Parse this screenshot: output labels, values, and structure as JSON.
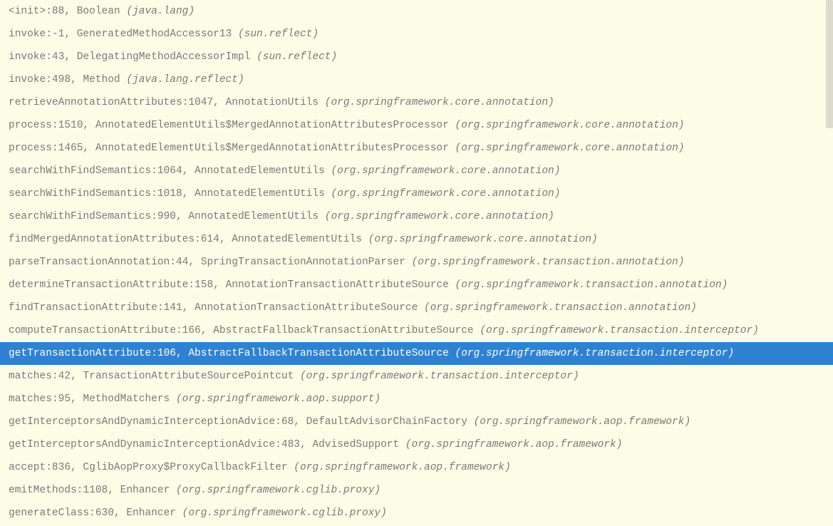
{
  "selectedIndex": 15,
  "frames": [
    {
      "method": "<init>",
      "line": "88",
      "cls": "Boolean",
      "pkg": "java.lang"
    },
    {
      "method": "invoke",
      "line": "-1",
      "cls": "GeneratedMethodAccessor13",
      "pkg": "sun.reflect"
    },
    {
      "method": "invoke",
      "line": "43",
      "cls": "DelegatingMethodAccessorImpl",
      "pkg": "sun.reflect"
    },
    {
      "method": "invoke",
      "line": "498",
      "cls": "Method",
      "pkg": "java.lang.reflect"
    },
    {
      "method": "retrieveAnnotationAttributes",
      "line": "1047",
      "cls": "AnnotationUtils",
      "pkg": "org.springframework.core.annotation"
    },
    {
      "method": "process",
      "line": "1510",
      "cls": "AnnotatedElementUtils$MergedAnnotationAttributesProcessor",
      "pkg": "org.springframework.core.annotation"
    },
    {
      "method": "process",
      "line": "1465",
      "cls": "AnnotatedElementUtils$MergedAnnotationAttributesProcessor",
      "pkg": "org.springframework.core.annotation"
    },
    {
      "method": "searchWithFindSemantics",
      "line": "1064",
      "cls": "AnnotatedElementUtils",
      "pkg": "org.springframework.core.annotation"
    },
    {
      "method": "searchWithFindSemantics",
      "line": "1018",
      "cls": "AnnotatedElementUtils",
      "pkg": "org.springframework.core.annotation"
    },
    {
      "method": "searchWithFindSemantics",
      "line": "990",
      "cls": "AnnotatedElementUtils",
      "pkg": "org.springframework.core.annotation"
    },
    {
      "method": "findMergedAnnotationAttributes",
      "line": "614",
      "cls": "AnnotatedElementUtils",
      "pkg": "org.springframework.core.annotation"
    },
    {
      "method": "parseTransactionAnnotation",
      "line": "44",
      "cls": "SpringTransactionAnnotationParser",
      "pkg": "org.springframework.transaction.annotation"
    },
    {
      "method": "determineTransactionAttribute",
      "line": "158",
      "cls": "AnnotationTransactionAttributeSource",
      "pkg": "org.springframework.transaction.annotation"
    },
    {
      "method": "findTransactionAttribute",
      "line": "141",
      "cls": "AnnotationTransactionAttributeSource",
      "pkg": "org.springframework.transaction.annotation"
    },
    {
      "method": "computeTransactionAttribute",
      "line": "166",
      "cls": "AbstractFallbackTransactionAttributeSource",
      "pkg": "org.springframework.transaction.interceptor"
    },
    {
      "method": "getTransactionAttribute",
      "line": "106",
      "cls": "AbstractFallbackTransactionAttributeSource",
      "pkg": "org.springframework.transaction.interceptor"
    },
    {
      "method": "matches",
      "line": "42",
      "cls": "TransactionAttributeSourcePointcut",
      "pkg": "org.springframework.transaction.interceptor"
    },
    {
      "method": "matches",
      "line": "95",
      "cls": "MethodMatchers",
      "pkg": "org.springframework.aop.support"
    },
    {
      "method": "getInterceptorsAndDynamicInterceptionAdvice",
      "line": "68",
      "cls": "DefaultAdvisorChainFactory",
      "pkg": "org.springframework.aop.framework"
    },
    {
      "method": "getInterceptorsAndDynamicInterceptionAdvice",
      "line": "483",
      "cls": "AdvisedSupport",
      "pkg": "org.springframework.aop.framework"
    },
    {
      "method": "accept",
      "line": "836",
      "cls": "CglibAopProxy$ProxyCallbackFilter",
      "pkg": "org.springframework.aop.framework"
    },
    {
      "method": "emitMethods",
      "line": "1108",
      "cls": "Enhancer",
      "pkg": "org.springframework.cglib.proxy"
    },
    {
      "method": "generateClass",
      "line": "630",
      "cls": "Enhancer",
      "pkg": "org.springframework.cglib.proxy"
    }
  ]
}
